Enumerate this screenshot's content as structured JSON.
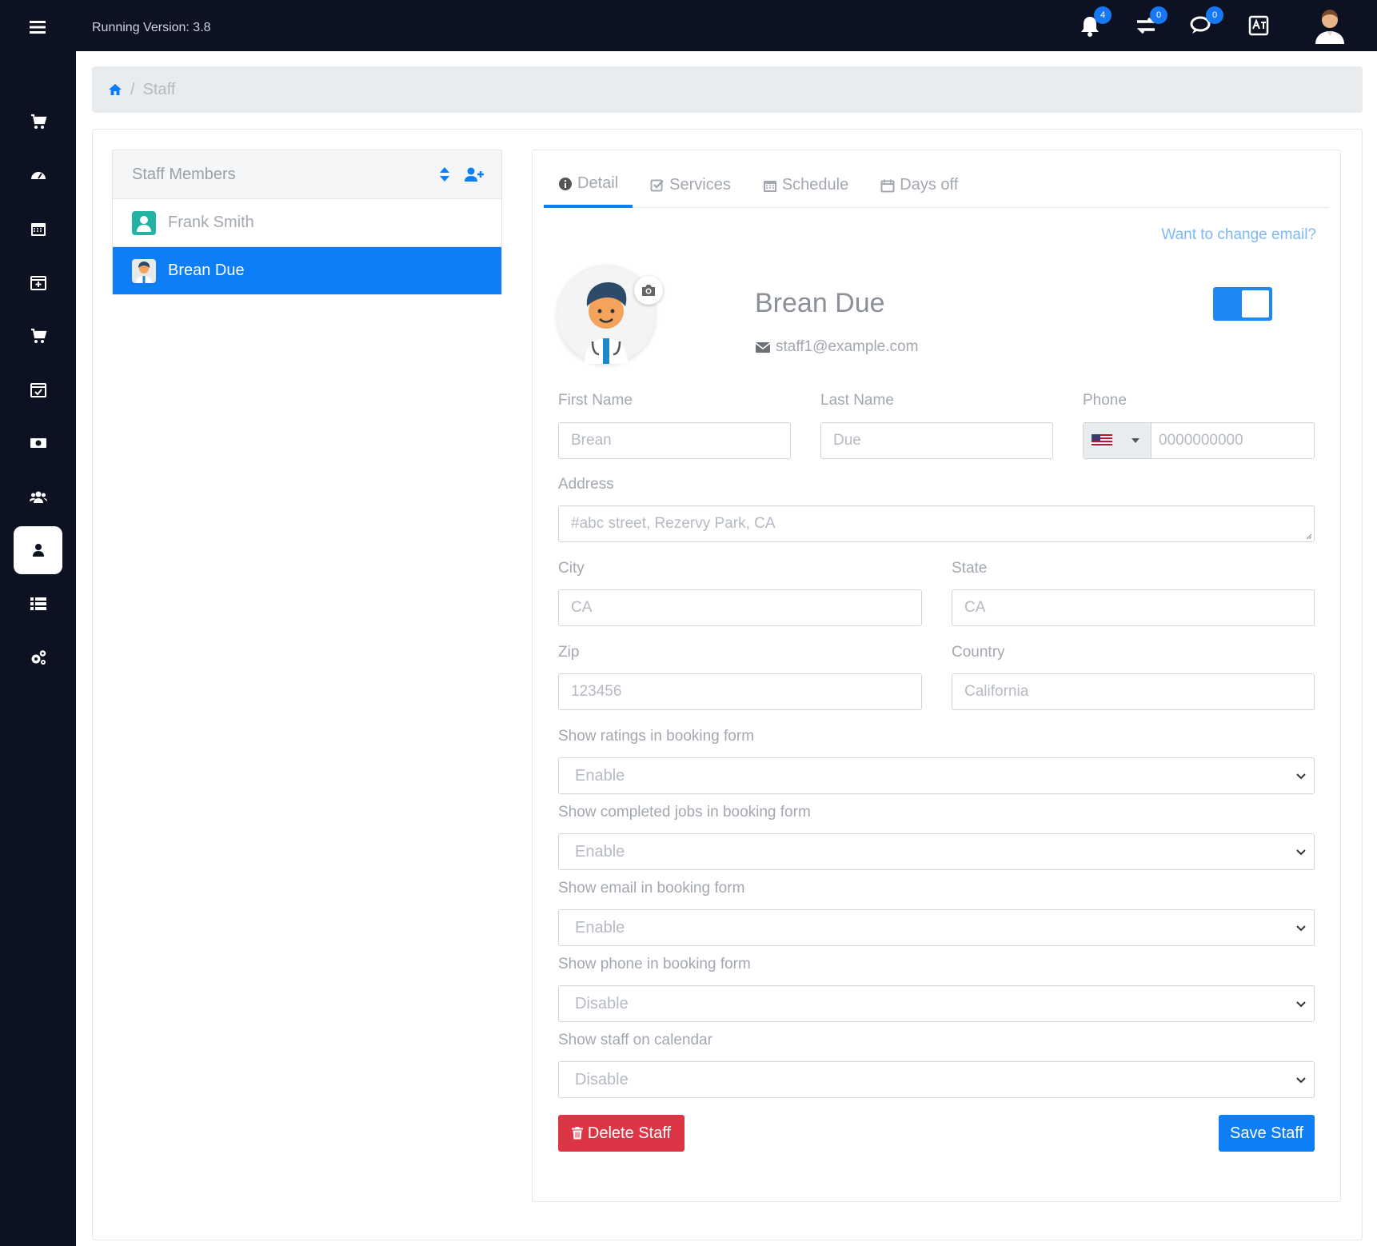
{
  "header": {
    "version_text": "Running Version: 3.8",
    "notifications_count": "4",
    "transfers_count": "0",
    "messages_count": "0"
  },
  "breadcrumb": {
    "current": "Staff"
  },
  "staff_panel": {
    "title": "Staff Members",
    "members": [
      {
        "name": "Frank Smith",
        "selected": false
      },
      {
        "name": "Brean Due",
        "selected": true
      }
    ]
  },
  "tabs": [
    {
      "label": "Detail",
      "icon": "info-icon",
      "active": true
    },
    {
      "label": "Services",
      "icon": "check-square-icon",
      "active": false
    },
    {
      "label": "Schedule",
      "icon": "calendar-icon",
      "active": false
    },
    {
      "label": "Days off",
      "icon": "calendar-blank-icon",
      "active": false
    }
  ],
  "profile": {
    "change_email_link": "Want to change email?",
    "name": "Brean Due",
    "email": "staff1@example.com",
    "active_toggle": true
  },
  "form": {
    "first_name_label": "First Name",
    "first_name_value": "Brean",
    "last_name_label": "Last Name",
    "last_name_value": "Due",
    "phone_label": "Phone",
    "phone_placeholder": "0000000000",
    "address_label": "Address",
    "address_value": "#abc street, Rezervy Park, CA",
    "city_label": "City",
    "city_value": "CA",
    "state_label": "State",
    "state_value": "CA",
    "zip_label": "Zip",
    "zip_value": "123456",
    "country_label": "Country",
    "country_value": "California",
    "selects": [
      {
        "label": "Show ratings in booking form",
        "value": "Enable"
      },
      {
        "label": "Show completed jobs in booking form",
        "value": "Enable"
      },
      {
        "label": "Show email in booking form",
        "value": "Enable"
      },
      {
        "label": "Show phone in booking form",
        "value": "Disable"
      },
      {
        "label": "Show staff on calendar",
        "value": "Disable"
      }
    ],
    "delete_label": "Delete Staff",
    "save_label": "Save Staff"
  },
  "colors": {
    "primary": "#0d7ef5",
    "danger": "#dc3545",
    "sidebar": "#0d1223"
  }
}
